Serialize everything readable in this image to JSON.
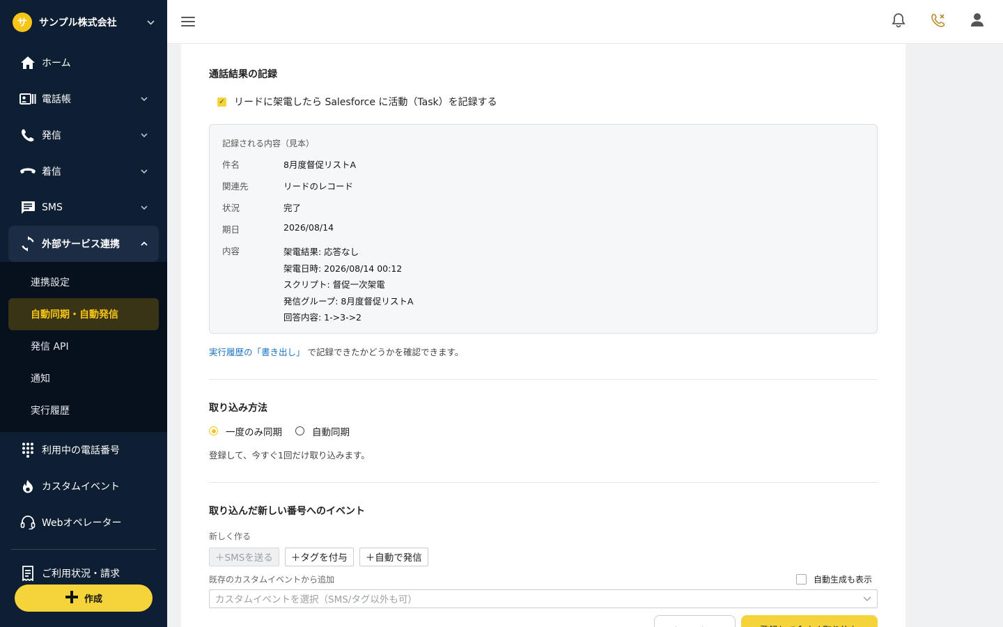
{
  "sidebar": {
    "company_logo": "サ",
    "company_name": "サンプル株式会社",
    "items": [
      {
        "label": "ホーム",
        "icon": "home-icon"
      },
      {
        "label": "電話帳",
        "icon": "contacts-icon"
      },
      {
        "label": "発信",
        "icon": "phone-outgoing-icon"
      },
      {
        "label": "着信",
        "icon": "phone-incoming-icon"
      },
      {
        "label": "SMS",
        "icon": "sms-icon"
      },
      {
        "label": "外部サービス連携",
        "icon": "sync-icon"
      }
    ],
    "subitems": [
      "連携設定",
      "自動同期・自動発信",
      "発信 API",
      "通知",
      "実行履歴"
    ],
    "items2": [
      {
        "label": "利用中の電話番号",
        "icon": "dialpad-icon"
      },
      {
        "label": "カスタムイベント",
        "icon": "fire-icon"
      },
      {
        "label": "Webオペレーター",
        "icon": "headset-icon"
      }
    ],
    "billing": "ご利用状況・請求",
    "create": "作成"
  },
  "main": {
    "record_title": "通話結果の記録",
    "record_checkbox": "リードに架電したら Salesforce に活動（Task）を記録する",
    "sample_head": "記録される内容（見本）",
    "sample": {
      "subject_k": "件名",
      "subject_v": "8月度督促リストA",
      "related_k": "関連先",
      "related_v": "リードのレコード",
      "status_k": "状況",
      "status_v": "完了",
      "due_k": "期日",
      "due_v": "2026/08/14",
      "content_k": "内容",
      "content_lines": [
        "架電結果: 応答なし",
        "架電日時: 2026/08/14 00:12",
        "スクリプト: 督促一次架電",
        "発信グループ: 8月度督促リストA",
        "回答内容: 1->3->2"
      ]
    },
    "note_link": "実行履歴の「書き出し」",
    "note_text": " で記録できたかどうかを確認できます。",
    "import_title": "取り込み方法",
    "radio_once": "一度のみ同期",
    "radio_auto": "自動同期",
    "import_help": "登録して、今すぐ1回だけ取り込みます。",
    "event_title": "取り込んだ新しい番号へのイベント",
    "new_label": "新しく作る",
    "btn_sms": "＋SMSを送る",
    "btn_tag": "＋タグを付与",
    "btn_auto": "＋自動で発信",
    "existing_label": "既存のカスタムイベントから追加",
    "show_auto": "自動生成も表示",
    "select_placeholder": "カスタムイベントを選択（SMS/タグ以外も可）",
    "cancel": "キャンセル",
    "submit": "登録して今すぐ取り込む"
  },
  "colors": {
    "accent": "#f5d33a",
    "sidebar_bg": "#0f1f33",
    "link": "#1a73c2"
  }
}
